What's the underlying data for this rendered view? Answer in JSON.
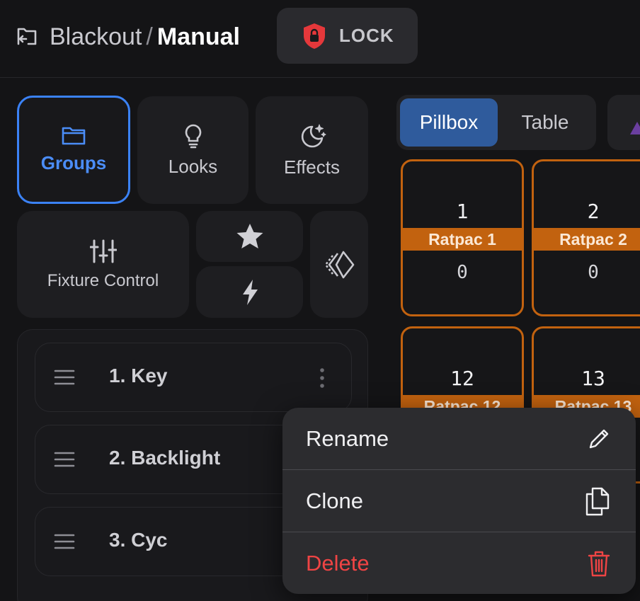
{
  "header": {
    "breadcrumb_parent": "Blackout",
    "breadcrumb_separator": "/",
    "breadcrumb_current": "Manual",
    "lock_label": "LOCK",
    "lock_color": "#e5383b"
  },
  "tiles": {
    "groups": "Groups",
    "looks": "Looks",
    "effects": "Effects",
    "fixture_control": "Fixture Control"
  },
  "groups_list": [
    {
      "label": "1. Key"
    },
    {
      "label": "2. Backlight"
    },
    {
      "label": "3. Cyc"
    }
  ],
  "view_toggle": {
    "options": [
      "Pillbox",
      "Table"
    ],
    "selected": "Pillbox"
  },
  "fixtures": [
    {
      "number": "1",
      "name": "Ratpac 1",
      "value": "0"
    },
    {
      "number": "2",
      "name": "Ratpac 2",
      "value": "0"
    },
    {
      "number": "12",
      "name": "Ratpac 12",
      "value": ""
    },
    {
      "number": "13",
      "name": "Ratpac 13",
      "value": ""
    }
  ],
  "context_menu": {
    "rename": "Rename",
    "clone": "Clone",
    "delete": "Delete"
  },
  "colors": {
    "accent": "#3b82f6",
    "fixture_orange": "#c2620f",
    "danger": "#ef4444",
    "selected_segment": "#2f5b9c"
  }
}
